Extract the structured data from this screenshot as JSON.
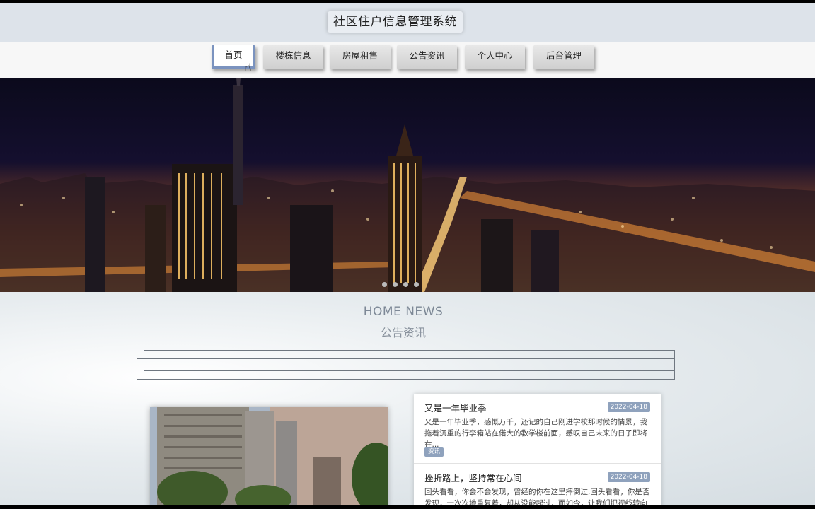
{
  "header": {
    "title": "社区住户信息管理系统"
  },
  "nav": {
    "items": [
      {
        "label": "首页",
        "active": true
      },
      {
        "label": "楼栋信息"
      },
      {
        "label": "房屋租售"
      },
      {
        "label": "公告资讯"
      },
      {
        "label": "个人中心"
      },
      {
        "label": "后台管理"
      }
    ]
  },
  "banner": {
    "slides": 4,
    "active_slide": 1
  },
  "news": {
    "heading_en": "HOME NEWS",
    "heading_cn": "公告资讯",
    "items": [
      {
        "title": "又是一年毕业季",
        "date": "2022-04-18",
        "excerpt": "又是一年毕业季，感慨万千，还记的自己刚进学校那时候的情景，我拖着沉重的行李箱站在偌大的教学楼前面，感叹自己未来的日子即将在...",
        "tag": "资讯"
      },
      {
        "title": "挫折路上，坚持常在心间",
        "date": "2022-04-18",
        "excerpt": "回头看看，你会不会发现，曾经的你在这里摔倒过,回头看看，你是否发现，一次次地重复着，却从没能起过，而如今，让我们把视线转向前..."
      }
    ]
  },
  "colors": {
    "accent": "#7b93bf",
    "tag": "#8fa2bd",
    "header_bg": "#dde3ea"
  }
}
